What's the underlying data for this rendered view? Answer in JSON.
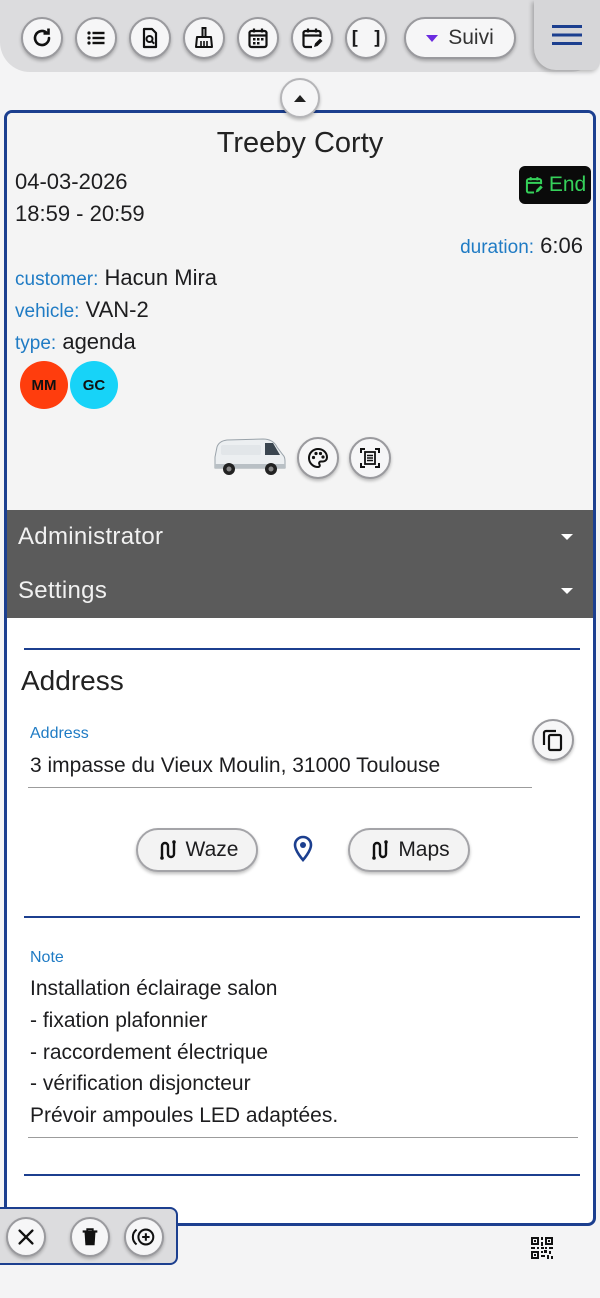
{
  "toolbar": {
    "icons": [
      "refresh-icon",
      "list-icon",
      "document-search-icon",
      "broom-icon",
      "calendar-icon",
      "calendar-edit-icon",
      "brackets-icon"
    ],
    "brackets_glyph": "[ ]",
    "suivi_label": "Suivi"
  },
  "event": {
    "title": "Treeby Corty",
    "date": "04-03-2026",
    "time_range": "18:59 - 20:59",
    "end_label": "End",
    "duration_label": "duration:",
    "duration_value": "6:06",
    "customer_label": "customer:",
    "customer_value": "Hacun Mira",
    "vehicle_label": "vehicle:",
    "vehicle_value": "VAN-2",
    "type_label": "type:",
    "type_value": "agenda",
    "avatars": [
      {
        "initials": "MM",
        "color": "#ff3d0d"
      },
      {
        "initials": "GC",
        "color": "#17d3f8"
      }
    ]
  },
  "sections": {
    "administrator_label": "Administrator",
    "settings_label": "Settings"
  },
  "address": {
    "section_title": "Address",
    "field_label": "Address",
    "value": "3 impasse du Vieux Moulin, 31000 Toulouse",
    "waze_label": "Waze",
    "maps_label": "Maps"
  },
  "note": {
    "field_label": "Note",
    "lines": [
      "Installation éclairage salon",
      "- fixation plafonnier",
      "- raccordement électrique",
      "- vérification disjoncteur",
      "Prévoir ampoules LED adaptées."
    ]
  },
  "colors": {
    "accent_blue": "#1c3f8f",
    "label_blue": "#1f7bc4",
    "end_green": "#35d15a",
    "accordion_gray": "#5b5b5b"
  }
}
